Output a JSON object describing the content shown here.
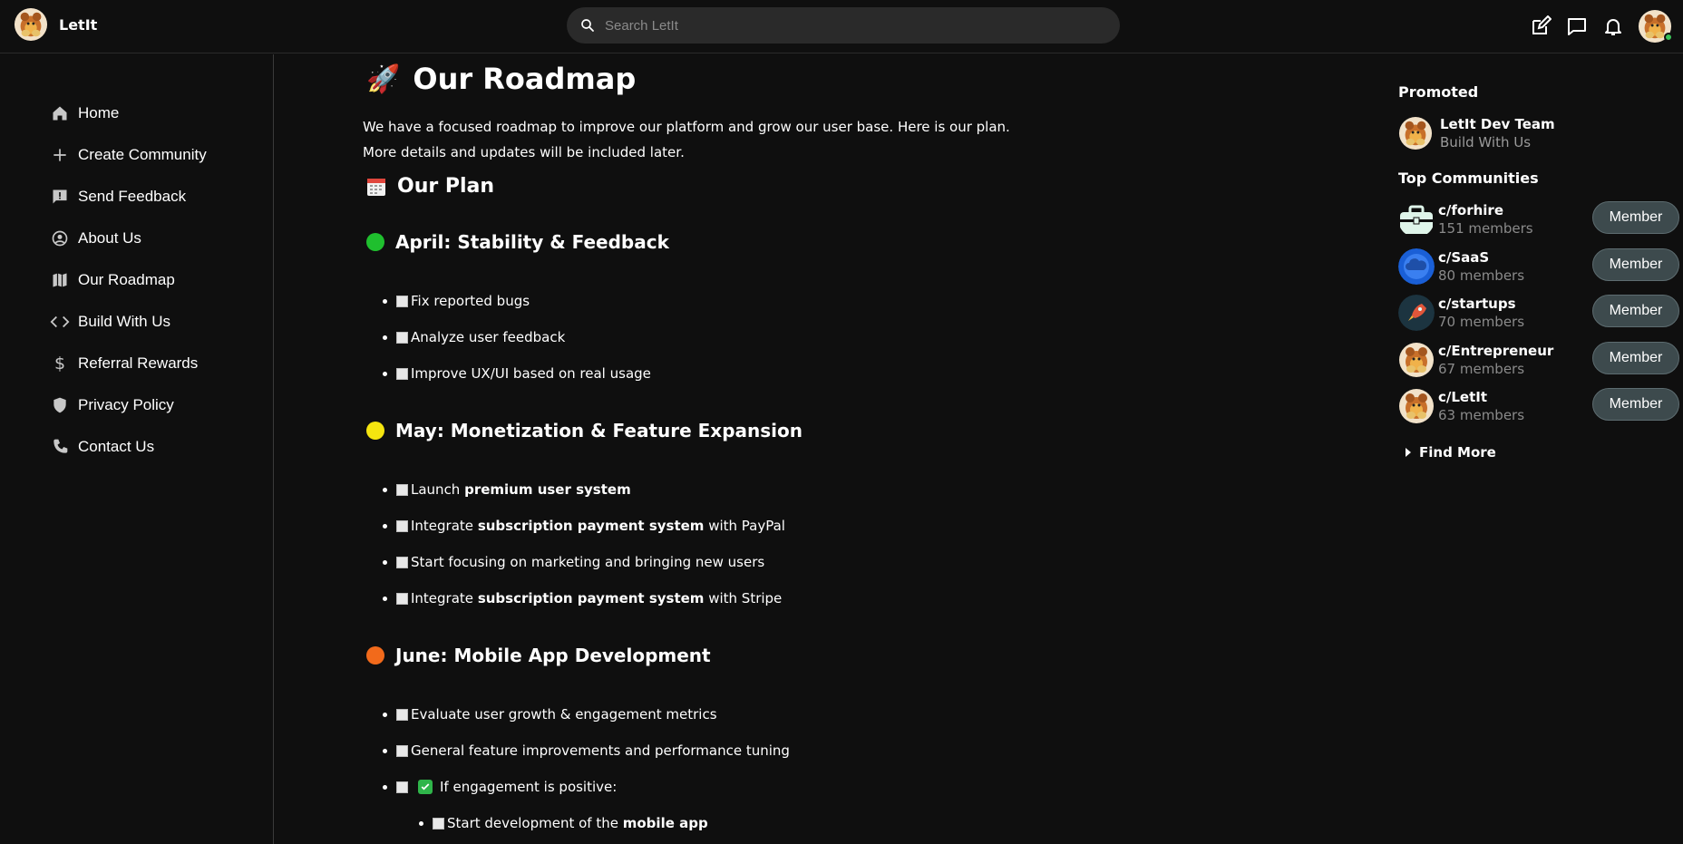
{
  "app": {
    "name": "LetIt"
  },
  "search": {
    "placeholder": "Search LetIt"
  },
  "topbar": {
    "icons": [
      "edit-icon",
      "chat-icon",
      "bell-icon",
      "user-avatar"
    ]
  },
  "sidebar": {
    "items": [
      {
        "label": "Home",
        "icon": "home-icon"
      },
      {
        "label": "Create Community",
        "icon": "plus-icon"
      },
      {
        "label": "Send Feedback",
        "icon": "feedback-icon"
      },
      {
        "label": "About Us",
        "icon": "account-circle-icon"
      },
      {
        "label": "Our Roadmap",
        "icon": "map-icon"
      },
      {
        "label": "Build With Us",
        "icon": "code-icon"
      },
      {
        "label": "Referral Rewards",
        "icon": "dollar-icon"
      },
      {
        "label": "Privacy Policy",
        "icon": "shield-icon"
      },
      {
        "label": "Contact Us",
        "icon": "phone-icon"
      }
    ]
  },
  "main": {
    "title_emoji": "🚀",
    "title": "Our Roadmap",
    "intro_line1": "We have a focused roadmap to improve our platform and grow our user base. Here is our plan.",
    "intro_line2": "More details and updates will be included later.",
    "plan_title": "Our Plan",
    "sections": [
      {
        "title": "April: Stability & Feedback",
        "color": "#1fbf2e",
        "items": [
          {
            "pre": "Fix reported bugs",
            "bold": "",
            "post": ""
          },
          {
            "pre": "Analyze user feedback",
            "bold": "",
            "post": ""
          },
          {
            "pre": "Improve UX/UI based on real usage",
            "bold": "",
            "post": ""
          }
        ]
      },
      {
        "title": "May: Monetization & Feature Expansion",
        "color": "#f5e50f",
        "items": [
          {
            "pre": "Launch ",
            "bold": "premium user system",
            "post": ""
          },
          {
            "pre": "Integrate ",
            "bold": "subscription payment system",
            "post": " with PayPal"
          },
          {
            "pre": "Start focusing on marketing and bringing new users",
            "bold": "",
            "post": ""
          },
          {
            "pre": "Integrate ",
            "bold": "subscription payment system",
            "post": " with Stripe"
          }
        ]
      },
      {
        "title": "June: Mobile App Development",
        "color": "#f26a1b",
        "items": [
          {
            "pre": "Evaluate user growth & engagement metrics",
            "bold": "",
            "post": ""
          },
          {
            "pre": "General feature improvements and performance tuning",
            "bold": "",
            "post": ""
          },
          {
            "pre": "If engagement is positive:",
            "bold": "",
            "post": ""
          },
          {
            "pre": "Start development of the ",
            "bold": "mobile app",
            "post": ""
          }
        ]
      }
    ]
  },
  "right": {
    "promoted_title": "Promoted",
    "promoted": {
      "name": "LetIt Dev Team",
      "subtitle": "Build With Us"
    },
    "top_title": "Top Communities",
    "communities": [
      {
        "name": "c/forhire",
        "members": "151 members",
        "button": "Member",
        "icon": "briefcase-icon"
      },
      {
        "name": "c/SaaS",
        "members": "80 members",
        "button": "Member",
        "icon": "cloud-icon"
      },
      {
        "name": "c/startups",
        "members": "70 members",
        "button": "Member",
        "icon": "rocket-icon"
      },
      {
        "name": "c/Entrepreneur",
        "members": "67 members",
        "button": "Member",
        "icon": "letit-logo"
      },
      {
        "name": "c/LetIt",
        "members": "63 members",
        "button": "Member",
        "icon": "letit-logo"
      }
    ],
    "find_more": "Find More"
  }
}
